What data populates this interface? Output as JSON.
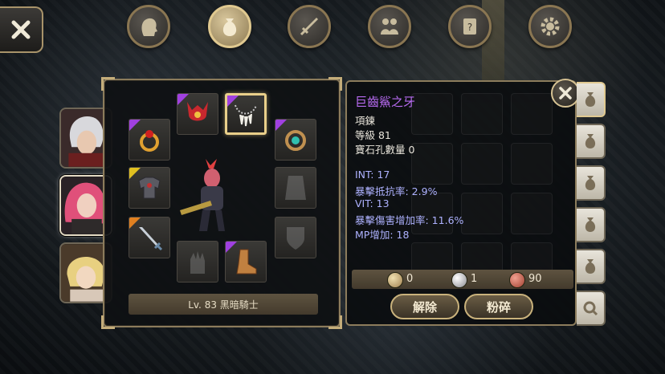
{
  "tabs": [
    {
      "name": "character-tab",
      "icon": "head-silhouette-icon",
      "active": false
    },
    {
      "name": "inventory-tab",
      "icon": "bag-icon",
      "active": true
    },
    {
      "name": "skills-tab",
      "icon": "sword-icon",
      "active": false
    },
    {
      "name": "party-tab",
      "icon": "people-icon",
      "active": false
    },
    {
      "name": "quest-tab",
      "icon": "scroll-icon",
      "active": false
    },
    {
      "name": "settings-tab",
      "icon": "gear-icon",
      "active": false
    }
  ],
  "equipment": {
    "level_label": "Lv. 83 黑暗騎士",
    "slots": [
      {
        "name": "helmet",
        "icon": "red-helmet-icon",
        "rarity": "#a040e0",
        "empty": false
      },
      {
        "name": "necklace",
        "icon": "fang-necklace-icon",
        "rarity": "#a040e0",
        "empty": false,
        "selected": true
      },
      {
        "name": "ring-left",
        "icon": "ruby-ring-icon",
        "rarity": "#a040e0",
        "empty": false
      },
      {
        "name": "ring-right",
        "icon": "emerald-ring-icon",
        "rarity": "#a040e0",
        "empty": false
      },
      {
        "name": "armor",
        "icon": "dark-armor-icon",
        "rarity": "#e0c020",
        "empty": false
      },
      {
        "name": "cloak",
        "icon": "cloak-icon",
        "empty": true
      },
      {
        "name": "weapon",
        "icon": "sword-icon",
        "rarity": "#e08020",
        "empty": false
      },
      {
        "name": "shield",
        "icon": "shield-icon",
        "empty": true
      },
      {
        "name": "gloves",
        "icon": "glove-icon",
        "empty": true
      },
      {
        "name": "boots",
        "icon": "boots-icon",
        "rarity": "#a040e0",
        "empty": false
      }
    ]
  },
  "item": {
    "name": "巨齒鯊之牙",
    "name_color": "#b86bf2",
    "type": "項鍊",
    "level": "等級 81",
    "sockets": "寶石孔數量 0",
    "attributes": [
      "INT: 17",
      "暴擊抵抗率: 2.9%",
      "VIT: 13",
      "暴擊傷害增加率: 11.6%",
      "MP增加: 18"
    ],
    "currencies": [
      {
        "icon": "gold-coin-icon",
        "value": "0"
      },
      {
        "icon": "silver-coin-icon",
        "value": "1"
      },
      {
        "icon": "copper-coin-icon",
        "value": "90"
      }
    ],
    "buttons": {
      "unequip": "解除",
      "smash": "粉碎"
    }
  },
  "colors": {
    "accent": "#e9cf8a",
    "attribute_text": "#aeb2ff",
    "epic": "#a040e0"
  }
}
